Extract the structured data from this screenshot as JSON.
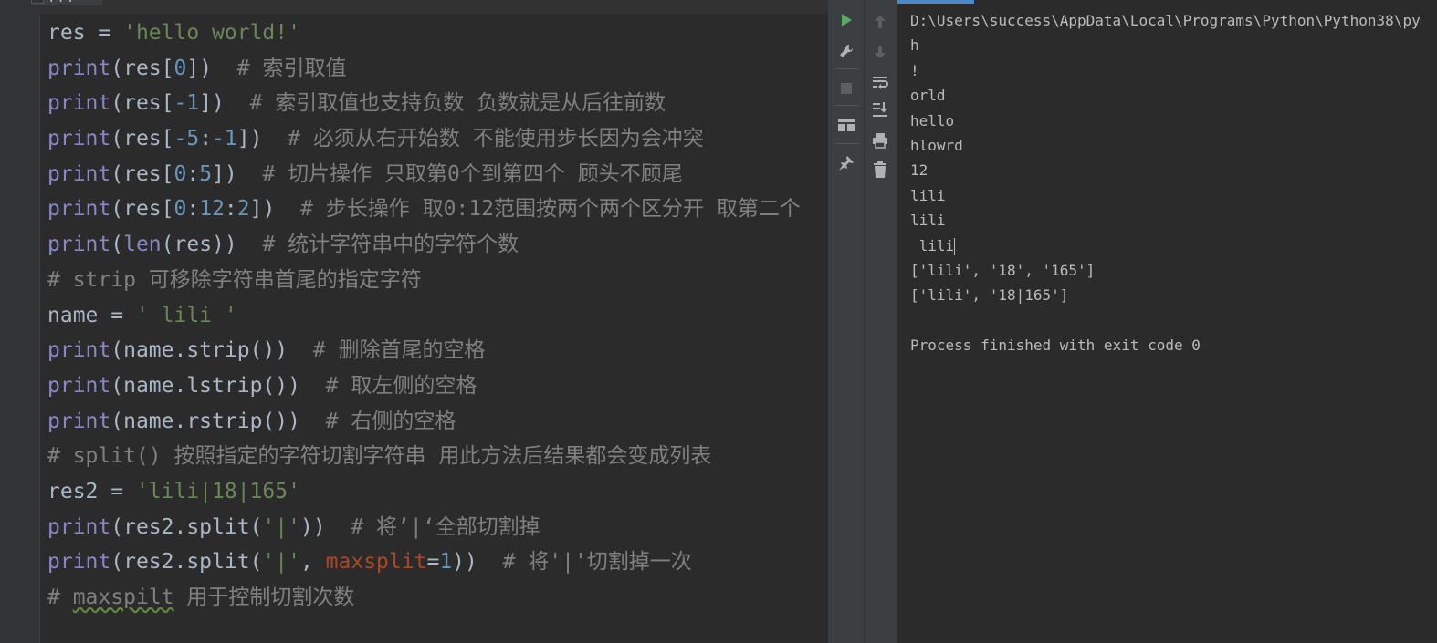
{
  "editor": {
    "fold_text": "...",
    "lines": [
      [
        {
          "t": "res = ",
          "c": ""
        },
        {
          "t": "'hello world!'",
          "c": "str"
        }
      ],
      [
        {
          "t": "print",
          "c": "kw-fn"
        },
        {
          "t": "(res[",
          "c": ""
        },
        {
          "t": "0",
          "c": "num"
        },
        {
          "t": "])  ",
          "c": ""
        },
        {
          "t": "# 索引取值",
          "c": "cmt"
        }
      ],
      [
        {
          "t": "print",
          "c": "kw-fn"
        },
        {
          "t": "(res[",
          "c": ""
        },
        {
          "t": "-1",
          "c": "num"
        },
        {
          "t": "])  ",
          "c": ""
        },
        {
          "t": "# 索引取值也支持负数 负数就是从后往前数",
          "c": "cmt"
        }
      ],
      [
        {
          "t": "print",
          "c": "kw-fn"
        },
        {
          "t": "(res[",
          "c": ""
        },
        {
          "t": "-5",
          "c": "num"
        },
        {
          "t": ":",
          "c": ""
        },
        {
          "t": "-1",
          "c": "num"
        },
        {
          "t": "])  ",
          "c": ""
        },
        {
          "t": "# 必须从右开始数 不能使用步长因为会冲突",
          "c": "cmt"
        }
      ],
      [
        {
          "t": "print",
          "c": "kw-fn"
        },
        {
          "t": "(res[",
          "c": ""
        },
        {
          "t": "0",
          "c": "num"
        },
        {
          "t": ":",
          "c": ""
        },
        {
          "t": "5",
          "c": "num"
        },
        {
          "t": "])  ",
          "c": ""
        },
        {
          "t": "# 切片操作 只取第0个到第四个 顾头不顾尾",
          "c": "cmt"
        }
      ],
      [
        {
          "t": "print",
          "c": "kw-fn"
        },
        {
          "t": "(res[",
          "c": ""
        },
        {
          "t": "0",
          "c": "num"
        },
        {
          "t": ":",
          "c": ""
        },
        {
          "t": "12",
          "c": "num"
        },
        {
          "t": ":",
          "c": ""
        },
        {
          "t": "2",
          "c": "num"
        },
        {
          "t": "])  ",
          "c": ""
        },
        {
          "t": "# 步长操作 取0:12范围按两个两个区分开 取第二个",
          "c": "cmt"
        }
      ],
      [
        {
          "t": "print",
          "c": "kw-fn"
        },
        {
          "t": "(",
          "c": ""
        },
        {
          "t": "len",
          "c": "kw-fn"
        },
        {
          "t": "(res))  ",
          "c": ""
        },
        {
          "t": "# 统计字符串中的字符个数",
          "c": "cmt"
        }
      ],
      [
        {
          "t": "# strip 可移除字符串首尾的指定字符",
          "c": "cmt"
        }
      ],
      [
        {
          "t": "name = ",
          "c": ""
        },
        {
          "t": "' lili '",
          "c": "str"
        }
      ],
      [
        {
          "t": "print",
          "c": "kw-fn"
        },
        {
          "t": "(name.strip())  ",
          "c": ""
        },
        {
          "t": "# 删除首尾的空格",
          "c": "cmt"
        }
      ],
      [
        {
          "t": "print",
          "c": "kw-fn"
        },
        {
          "t": "(name.lstrip())  ",
          "c": ""
        },
        {
          "t": "# 取左侧的空格",
          "c": "cmt"
        }
      ],
      [
        {
          "t": "print",
          "c": "kw-fn"
        },
        {
          "t": "(name.rstrip())  ",
          "c": ""
        },
        {
          "t": "# 右侧的空格",
          "c": "cmt"
        }
      ],
      [
        {
          "t": "# split() 按照指定的字符切割字符串 用此方法后结果都会变成列表",
          "c": "cmt"
        }
      ],
      [
        {
          "t": "res2 = ",
          "c": ""
        },
        {
          "t": "'lili|18|165'",
          "c": "str"
        }
      ],
      [
        {
          "t": "print",
          "c": "kw-fn"
        },
        {
          "t": "(res2.split(",
          "c": ""
        },
        {
          "t": "'|'",
          "c": "str"
        },
        {
          "t": "))  ",
          "c": ""
        },
        {
          "t": "# 将’|‘全部切割掉",
          "c": "cmt"
        }
      ],
      [
        {
          "t": "print",
          "c": "kw-fn"
        },
        {
          "t": "(res2.split(",
          "c": ""
        },
        {
          "t": "'|'",
          "c": "str"
        },
        {
          "t": ", ",
          "c": ""
        },
        {
          "t": "maxsplit",
          "c": "param"
        },
        {
          "t": "=",
          "c": ""
        },
        {
          "t": "1",
          "c": "num"
        },
        {
          "t": "))  ",
          "c": ""
        },
        {
          "t": "# 将'|'切割掉一次",
          "c": "cmt"
        }
      ],
      [
        {
          "t": "# ",
          "c": "cmt"
        },
        {
          "t": "maxspilt",
          "c": "cmt typo"
        },
        {
          "t": " 用于控制切割次数",
          "c": "cmt"
        }
      ]
    ]
  },
  "console": {
    "lines": [
      "D:\\Users\\success\\AppData\\Local\\Programs\\Python\\Python38\\py",
      "h",
      "!",
      "orld",
      "hello",
      "hlowrd",
      "12",
      "lili",
      "lili",
      " lili",
      "['lili', '18', '165']",
      "['lili', '18|165']",
      "",
      "Process finished with exit code 0"
    ],
    "caret_line": 9
  },
  "toolbar": {
    "left_icons": [
      "run-icon",
      "wrench-icon",
      "stop-icon",
      "layout-icon",
      "pin-icon"
    ],
    "right_icons": [
      "arrow-up-icon",
      "arrow-down-icon",
      "soft-wrap-icon",
      "scroll-to-end-icon",
      "print-icon",
      "trash-icon"
    ]
  },
  "colors": {
    "background": "#2b2b2b",
    "builtin": "#8888c6",
    "string": "#6a8759",
    "number": "#6897bb",
    "comment": "#808080",
    "param": "#aa4926",
    "run_green": "#59a869",
    "progress": "#4a88c7"
  }
}
